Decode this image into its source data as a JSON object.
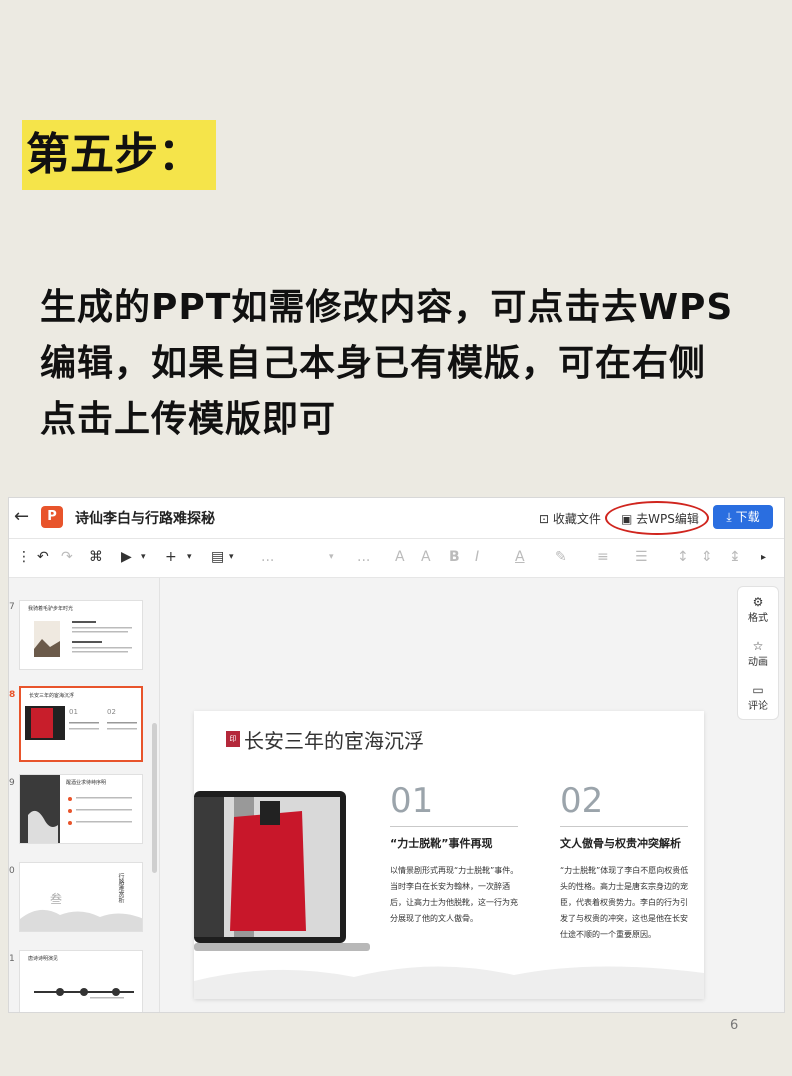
{
  "step_title": "第五步：",
  "description": [
    "生成的PPT如需修改内容，可点击去WPS",
    "编辑，如果自己本身已有模版，可在右侧",
    "点击上传模版即可"
  ],
  "app": {
    "logo_letter": "P",
    "doc_title": "诗仙李白与行路难探秘",
    "favorite_label": "收藏文件",
    "wps_edit_label": "去WPS编辑",
    "download_label": "下载",
    "highlight_color": "#d0251e",
    "accent_color": "#2a6ee0"
  },
  "toolbar": {
    "ellipsis": "..."
  },
  "thumbnails": [
    {
      "num": "7",
      "title": "我骑着毛驴步年时光"
    },
    {
      "num": "8",
      "title": "长安三年的宦海沉浮"
    },
    {
      "num": "9",
      "title": "醒酒业求待峙序明"
    },
    {
      "num": "0",
      "title": "行路难赏析"
    },
    {
      "num": "1",
      "title": "唐诗诗明演见"
    }
  ],
  "right_panel": {
    "format": "格式",
    "animation": "动画",
    "comment": "评论"
  },
  "slide": {
    "seal_text": "印",
    "heading": "长安三年的宦海沉浮",
    "col1": {
      "num": "01",
      "head": "“力士脱靴”事件再现",
      "body": "以情景剧形式再现“力士脱靴”事件。当时李白在长安为翰林，一次醉酒后，让高力士为他脱靴，这一行为充分展现了他的文人傲骨。"
    },
    "col2": {
      "num": "02",
      "head": "文人傲骨与权贵冲突解析",
      "body": "“力士脱靴”体现了李白不愿向权贵低头的性格。高力士是唐玄宗身边的宠臣，代表着权贵势力。李白的行为引发了与权贵的冲突，这也是他在长安仕途不顺的一个重要原因。"
    }
  },
  "page_number": "6"
}
